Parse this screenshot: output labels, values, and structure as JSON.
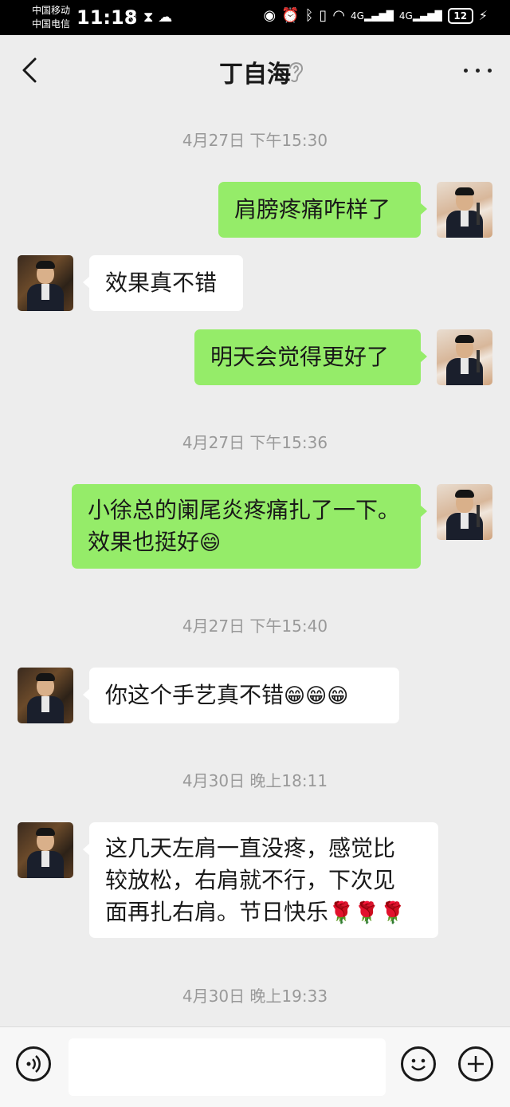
{
  "status_bar": {
    "carrier_1": "中国移动",
    "carrier_2": "中国电信",
    "time": "11:18",
    "net_1": "4G",
    "net_2": "4G",
    "battery": "12"
  },
  "header": {
    "title": "丁自海"
  },
  "messages": [
    {
      "type": "time",
      "text": "4月27日 下午15:30"
    },
    {
      "type": "out",
      "text": "肩膀疼痛咋样了"
    },
    {
      "type": "in",
      "text": "效果真不错"
    },
    {
      "type": "out",
      "text": "明天会觉得更好了"
    },
    {
      "type": "time",
      "text": "4月27日 下午15:36"
    },
    {
      "type": "out",
      "line1": "小徐总的阑尾炎疼痛扎了一下。",
      "line2": "效果也挺好",
      "emoji": "😄"
    },
    {
      "type": "time",
      "text": "4月27日 下午15:40"
    },
    {
      "type": "in",
      "text": "你这个手艺真不错",
      "emoji": "😁😁😁"
    },
    {
      "type": "time",
      "text": "4月30日 晚上18:11"
    },
    {
      "type": "in",
      "line1": "这几天左肩一直没疼，感觉比",
      "line2": "较放松，右肩就不行，下次见",
      "line3": "面再扎右肩。节日快乐",
      "emoji": "🌹🌹🌹"
    },
    {
      "type": "time",
      "text": "4月30日 晚上19:33"
    }
  ],
  "colors": {
    "background": "#ededed",
    "out_bubble": "#95ec69",
    "in_bubble": "#ffffff",
    "timestamp": "#999999"
  },
  "icons": [
    "back-icon",
    "ear-icon",
    "more-icon",
    "voice-icon",
    "emoji-icon",
    "plus-icon"
  ]
}
